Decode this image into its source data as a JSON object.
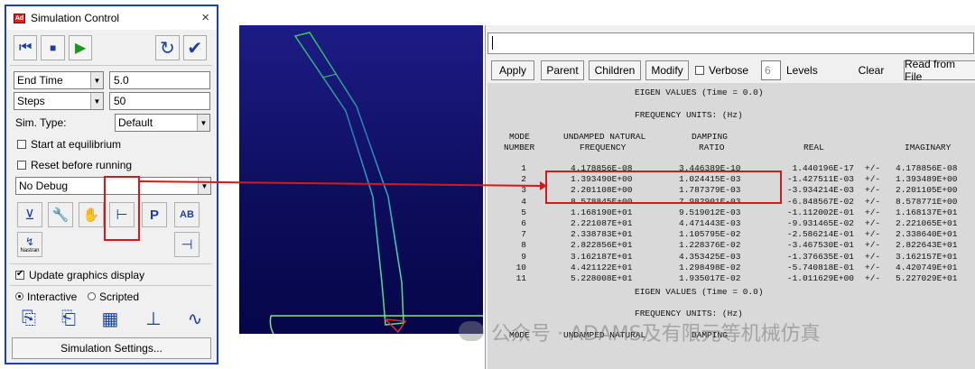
{
  "dialog": {
    "title": "Simulation Control",
    "close": "×",
    "app_icon": "Ad",
    "toolbar": {
      "rewind_icon": "⏮",
      "stop_icon": "■",
      "play_icon": "▶",
      "reset_icon": "↻",
      "apply_icon": "✔"
    },
    "end_time": {
      "selected": "End Time",
      "value": "5.0"
    },
    "steps": {
      "selected": "Steps",
      "value": "50"
    },
    "sim_type_label": "Sim. Type:",
    "sim_type_value": "Default",
    "start_equilibrium": "Start at equilibrium",
    "reset_before": "Reset before running",
    "debug_value": "No Debug",
    "nastran_label": "Nastran",
    "tool_icons": {
      "a": "⊻",
      "b": "🔧",
      "c": "✋",
      "d": "⊢",
      "e": "P",
      "f": "AB",
      "g": "↯",
      "h": "⊣"
    },
    "update_graphics": "Update graphics display",
    "interactive": "Interactive",
    "scripted": "Scripted",
    "settings_button": "Simulation Settings..."
  },
  "info": {
    "buttons": {
      "apply": "Apply",
      "parent": "Parent",
      "children": "Children",
      "modify": "Modify",
      "verbose": "Verbose",
      "levels_value": "6",
      "levels": "Levels",
      "clear": "Clear",
      "read_file": "Read from File"
    },
    "heading1": "EIGEN VALUES (Time = 0.0)",
    "freq_units1": "FREQUENCY UNITS: (Hz)",
    "col_mode": "MODE",
    "col_number": "NUMBER",
    "col_undamped": "UNDAMPED NATURAL",
    "col_frequency": "FREQUENCY",
    "col_damping": "DAMPING",
    "col_ratio": "RATIO",
    "col_real": "REAL",
    "col_imag": "IMAGINARY",
    "rows": [
      {
        "n": "1",
        "f": "4.178856E-08",
        "d": "3.446389E-10",
        "r": "1.440196E-17",
        "pm": "+/-",
        "i": "4.178856E-08"
      },
      {
        "n": "2",
        "f": "1.393490E+00",
        "d": "1.024415E-03",
        "r": "-1.427511E-03",
        "pm": "+/-",
        "i": "1.393489E+00"
      },
      {
        "n": "3",
        "f": "2.201108E+00",
        "d": "1.787379E-03",
        "r": "-3.934214E-03",
        "pm": "+/-",
        "i": "2.201105E+00"
      },
      {
        "n": "4",
        "f": "8.578845E+00",
        "d": "7.982901E-03",
        "r": "-6.848567E-02",
        "pm": "+/-",
        "i": "8.578771E+00"
      },
      {
        "n": "5",
        "f": "1.168190E+01",
        "d": "9.519012E-03",
        "r": "-1.112002E-01",
        "pm": "+/-",
        "i": "1.168137E+01"
      },
      {
        "n": "6",
        "f": "2.221087E+01",
        "d": "4.471443E-03",
        "r": "-9.931465E-02",
        "pm": "+/-",
        "i": "2.221065E+01"
      },
      {
        "n": "7",
        "f": "2.338783E+01",
        "d": "1.105795E-02",
        "r": "-2.586214E-01",
        "pm": "+/-",
        "i": "2.338640E+01"
      },
      {
        "n": "8",
        "f": "2.822856E+01",
        "d": "1.228376E-02",
        "r": "-3.467530E-01",
        "pm": "+/-",
        "i": "2.822643E+01"
      },
      {
        "n": "9",
        "f": "3.162187E+01",
        "d": "4.353425E-03",
        "r": "-1.376635E-01",
        "pm": "+/-",
        "i": "3.162157E+01"
      },
      {
        "n": "10",
        "f": "4.421122E+01",
        "d": "1.298498E-02",
        "r": "-5.740818E-01",
        "pm": "+/-",
        "i": "4.420749E+01"
      },
      {
        "n": "11",
        "f": "5.228008E+01",
        "d": "1.935017E-02",
        "r": "-1.011629E+00",
        "pm": "+/-",
        "i": "5.227029E+01"
      }
    ],
    "heading2": "EIGEN VALUES (Time = 0.0)",
    "freq_units2": "FREQUENCY UNITS: (Hz)",
    "partial_mode": "MODE",
    "partial_undamped": "UNDAMPED NATURAL",
    "partial_damping": "DAMPING"
  },
  "watermark": "公众号 · ADAMS及有限元等机械仿真",
  "colors": {
    "highlight_red": "#d31a1a",
    "title_blue": "#1f3fbf"
  }
}
